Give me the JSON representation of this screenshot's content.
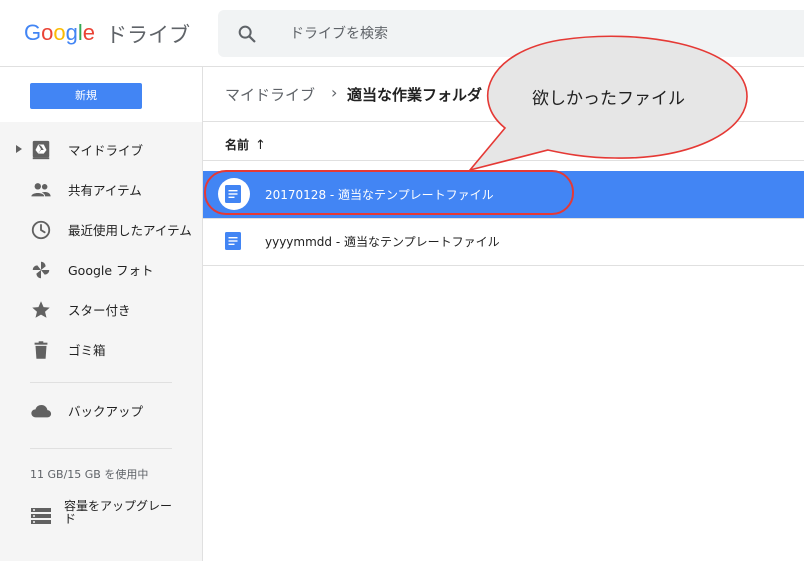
{
  "header": {
    "logo_text": "Google",
    "product_name": "ドライブ",
    "search_placeholder": "ドライブを検索"
  },
  "sidebar": {
    "new_button": "新規",
    "items": [
      {
        "label": "マイドライブ",
        "icon": "my-drive-icon"
      },
      {
        "label": "共有アイテム",
        "icon": "people-icon"
      },
      {
        "label": "最近使用したアイテム",
        "icon": "clock-icon"
      },
      {
        "label": "Google フォト",
        "icon": "pinwheel-icon"
      },
      {
        "label": "スター付き",
        "icon": "star-icon"
      },
      {
        "label": "ゴミ箱",
        "icon": "trash-icon"
      },
      {
        "label": "バックアップ",
        "icon": "cloud-icon"
      }
    ],
    "storage_text": "11 GB/15 GB を使用中",
    "upgrade_label": "容量をアップグレード"
  },
  "breadcrumb": {
    "root": "マイドライブ",
    "separator": "›",
    "current": "適当な作業フォルダ"
  },
  "file_list": {
    "column_header": "名前",
    "sort_indicator": "↑",
    "files": [
      {
        "name": "20170128 - 適当なテンプレートファイル",
        "selected": true
      },
      {
        "name": "yyyymmdd - 適当なテンプレートファイル",
        "selected": false
      }
    ]
  },
  "annotation": {
    "callout_text": "欲しかったファイル",
    "outline_color": "#e53935"
  },
  "colors": {
    "accent": "#4285f4",
    "sidebar_bg": "#f5f5f5"
  }
}
